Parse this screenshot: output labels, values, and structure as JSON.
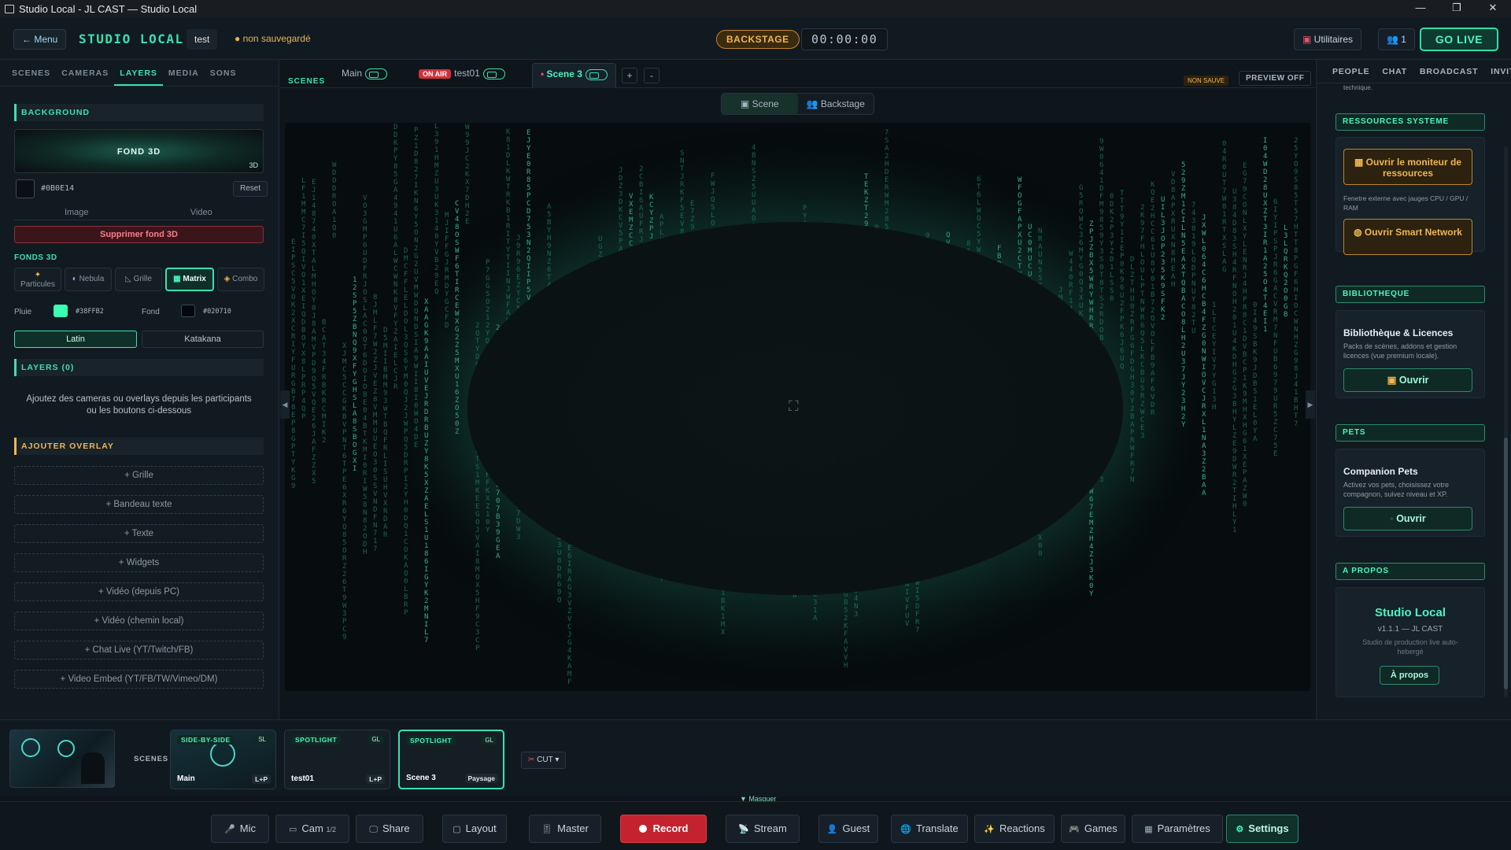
{
  "window": {
    "title": "Studio Local - JL CAST — Studio Local"
  },
  "topbar": {
    "menu": "← Menu",
    "brand": "STUDIO LOCAL",
    "project": "test",
    "unsaved": "● non sauvegardé",
    "backstage": "BACKSTAGE",
    "timer": "00:00:00",
    "utilities": "Utilitaires",
    "people_count": "1",
    "go_live": "GO LIVE"
  },
  "left": {
    "tabs": [
      "SCENES",
      "CAMERAS",
      "LAYERS",
      "MEDIA",
      "SONS"
    ],
    "background": {
      "heading": "BACKGROUND",
      "preview_label": "FOND 3D",
      "preview_badge": "3D",
      "color": "#0B0E14",
      "reset": "Reset",
      "image": "Image",
      "video": "Video",
      "delete": "Supprimer fond 3D"
    },
    "fonds": {
      "label": "FONDS 3D",
      "options": [
        "Particules",
        "Nebula",
        "Grille",
        "Matrix",
        "Combo"
      ],
      "active": "Matrix",
      "rain_label": "Pluie",
      "rain_color": "#38FFB2",
      "bg_label": "Fond",
      "bg_color": "#020710",
      "alphabets": [
        "Latin",
        "Katakana"
      ]
    },
    "layers": {
      "heading": "LAYERS (0)",
      "empty": "Ajoutez des cameras ou overlays depuis les participants ou les boutons ci-dessous"
    },
    "overlay": {
      "heading": "AJOUTER OVERLAY",
      "buttons": [
        "+ Grille",
        "+ Bandeau texte",
        "+ Texte",
        "+ Widgets",
        "+ Vidéo (depuis PC)",
        "+ Vidéo (chemin local)",
        "+ Chat Live (YT/Twitch/FB)",
        "+ Video Embed (YT/FB/TW/Vimeo/DM)"
      ]
    }
  },
  "center": {
    "scenes_label": "SCENES",
    "tabs": {
      "main": "Main",
      "onair": "ON AIR",
      "test01": "test01",
      "scene3": "Scene 3"
    },
    "add": "+",
    "remove": "-",
    "non_sauve": "NON SAUVE",
    "preview_off": "PREVIEW OFF",
    "view_scene": "Scene",
    "view_backstage": "Backstage"
  },
  "strip": {
    "scenes_label": "SCENES",
    "thumbs": [
      {
        "tag": "SIDE-BY-SIDE",
        "badge": "SL",
        "name": "Main",
        "mode": "L+P"
      },
      {
        "tag": "SPOTLIGHT",
        "badge": "GL",
        "name": "test01",
        "mode": "L+P"
      },
      {
        "tag": "SPOTLIGHT",
        "badge": "GL",
        "name": "Scene 3",
        "mode": "Paysage"
      }
    ],
    "cut": "CUT",
    "masquer": "▼ Masquer"
  },
  "toolbar": {
    "mic": "Mic",
    "cam": "Cam",
    "cam_count": "1/2",
    "share": "Share",
    "layout": "Layout",
    "master": "Master",
    "record": "Record",
    "stream": "Stream",
    "guest": "Guest",
    "translate": "Translate",
    "reactions": "Reactions",
    "games": "Games",
    "params": "Paramètres",
    "settings": "Settings"
  },
  "right": {
    "tabs": [
      "PEOPLE",
      "CHAT",
      "BROADCAST",
      "INVIT"
    ],
    "top_fragment": "technique.",
    "resources": {
      "heading": "RESSOURCES SYSTEME",
      "monitor": "Ouvrir le moniteur de ressources",
      "monitor_desc": "Fenetre externe avec jauges CPU / GPU / RAM",
      "network": "Ouvrir Smart Network"
    },
    "library": {
      "heading": "BIBLIOTHEQUE",
      "title": "Bibliothèque & Licences",
      "desc": "Packs de scènes, addons et gestion licences (vue premium locale).",
      "open": "Ouvrir"
    },
    "pets": {
      "heading": "PETS",
      "title": "Companion Pets",
      "desc": "Activez vos pets, choisissez votre compagnon, suivez niveau et XP.",
      "open": "Ouvrir"
    },
    "about": {
      "heading": "A PROPOS",
      "title": "Studio Local",
      "version": "v1.1.1 — JL CAST",
      "desc": "Studio de production live auto-hebergé",
      "button": "À propos"
    }
  }
}
